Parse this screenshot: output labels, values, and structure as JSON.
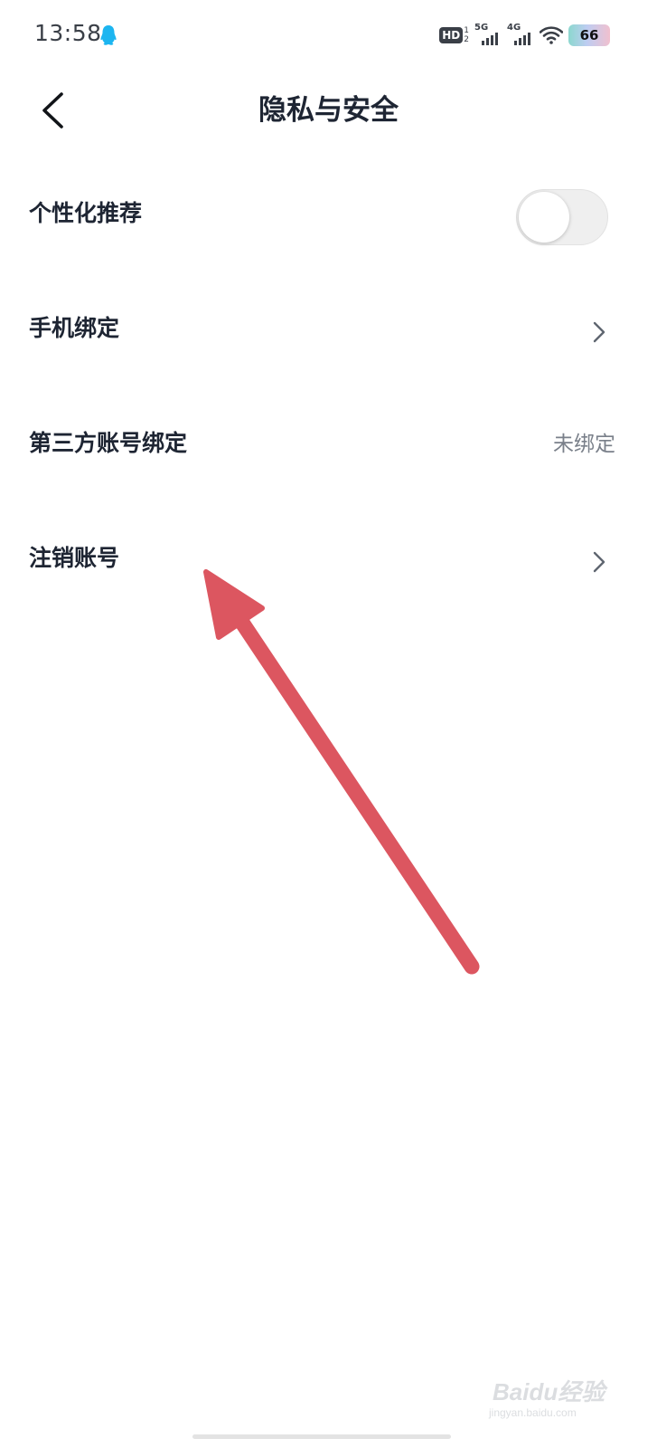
{
  "status_bar": {
    "time": "13:58",
    "hd_label": "HD",
    "hd_sim_top": "1",
    "hd_sim_bottom": "2",
    "signal_1_label": "5G",
    "signal_2_label": "4G",
    "battery": "66",
    "notification_icon": "qq-penguin-icon",
    "wifi_icon": "wifi-icon"
  },
  "header": {
    "back_icon": "chevron-left-icon",
    "title": "隐私与安全"
  },
  "settings": {
    "items": [
      {
        "label": "个性化推荐",
        "control": "toggle",
        "toggle_on": false
      },
      {
        "label": "手机绑定",
        "control": "chevron"
      },
      {
        "label": "第三方账号绑定",
        "control": "value",
        "value": "未绑定"
      },
      {
        "label": "注销账号",
        "control": "chevron"
      }
    ]
  },
  "annotation": {
    "type": "arrow",
    "color": "#dc5660",
    "points_to": "注销账号"
  },
  "watermark": {
    "brand": "Baidu经验",
    "sub": "jingyan.baidu.com"
  },
  "colors": {
    "text_primary": "#1e2533",
    "text_secondary": "#7a808a",
    "background": "#ffffff",
    "toggle_off_track": "#efefef"
  }
}
